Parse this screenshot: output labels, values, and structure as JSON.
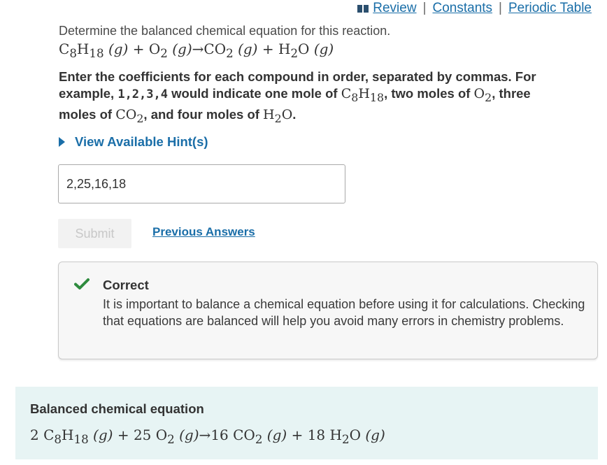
{
  "nav": {
    "review": "Review",
    "constants": "Constants",
    "periodic_table": "Periodic Table",
    "separator": "|"
  },
  "question": {
    "prompt": "Determine the balanced chemical equation for this reaction.",
    "equation": {
      "r1": "C",
      "r1_sub1": "8",
      "r1_h": "H",
      "r1_sub2": "18",
      "r1_state": "(g)",
      "plus1": "+",
      "r2": "O",
      "r2_sub": "2",
      "r2_state": "(g)",
      "arrow": "→",
      "p1": "CO",
      "p1_sub": "2",
      "p1_state": "(g)",
      "plus2": "+",
      "p2": "H",
      "p2_sub": "2",
      "p2_o": "O",
      "p2_state": "(g)"
    }
  },
  "instructions": {
    "part1": "Enter the coefficients for each compound in order, separated by commas. For example, ",
    "example": "1,2,3,4",
    "part2": " would indicate one mole of ",
    "part3": ", two moles of ",
    "part4": ", three moles of ",
    "part5": ", and four moles of ",
    "part6": "."
  },
  "hint": {
    "label": "View Available Hint(s)"
  },
  "answer": {
    "value": "2,25,16,18"
  },
  "actions": {
    "submit": "Submit",
    "previous_answers": "Previous Answers"
  },
  "feedback": {
    "title": "Correct",
    "body": "It is important to balance a chemical equation before using it for calculations. Checking that equations are balanced will help you avoid many errors in chemistry problems."
  },
  "result": {
    "title": "Balanced chemical equation",
    "coef1": "2",
    "coef2": "25",
    "coef3": "16",
    "coef4": "18"
  },
  "colors": {
    "link": "#1a6ea8",
    "check_green": "#2e8b3e",
    "result_bg": "#e7f4f4"
  },
  "icons": {
    "nav": "book-icon",
    "hint": "triangle-right-icon",
    "feedback": "checkmark-icon"
  }
}
